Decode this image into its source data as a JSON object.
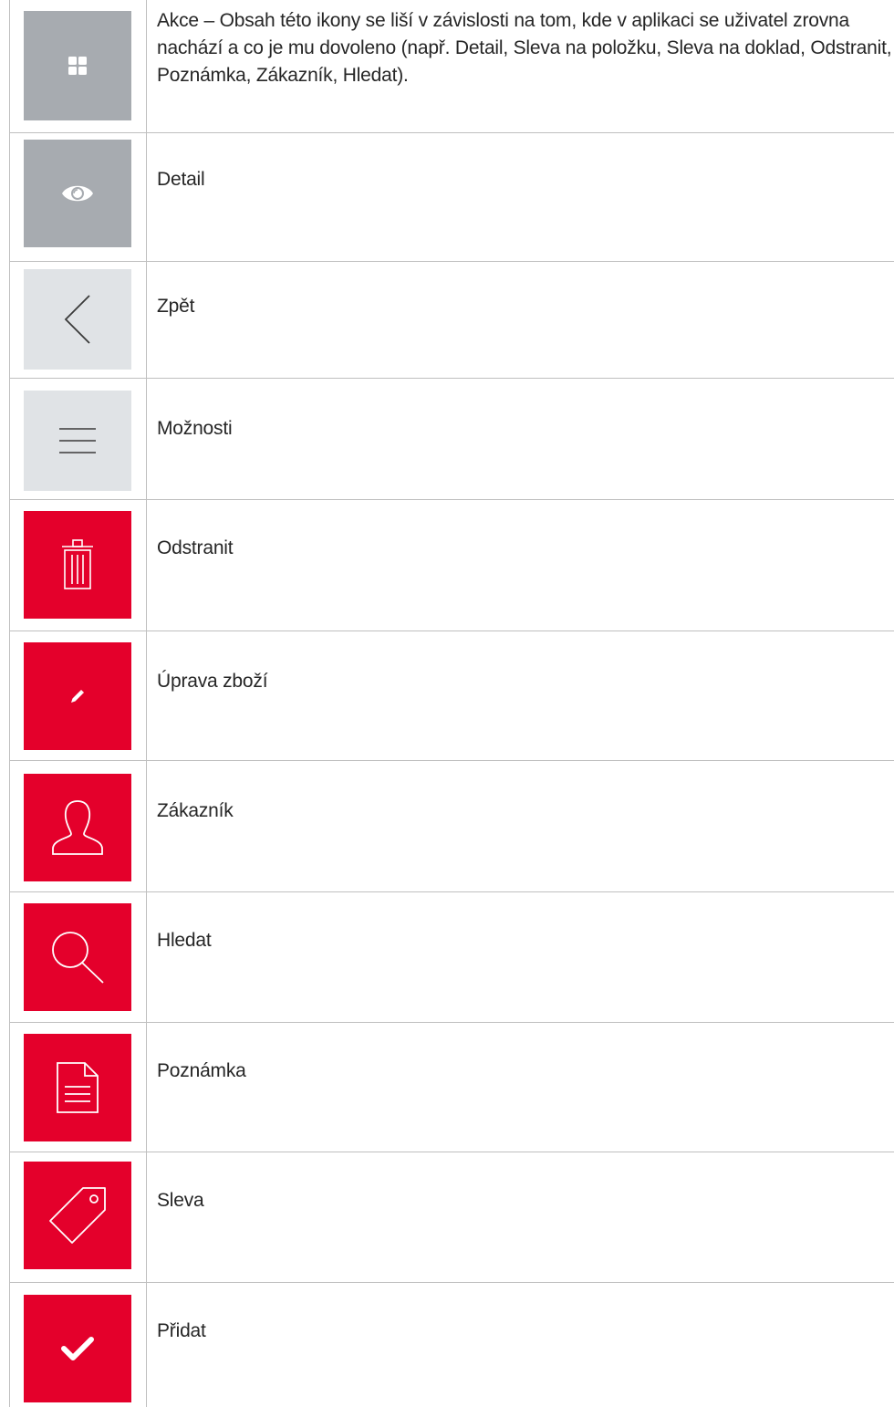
{
  "rows": [
    {
      "label": "Akce – Obsah této ikony se liší v závislosti na tom, kde v aplikaci se uživatel zrovna nachází a co je mu dovoleno (např. Detail, Sleva na položku, Sleva na doklad, Odstranit, Poznámka, Zákazník, Hledat).",
      "icon": "grid-icon",
      "tile_color": "#a7abb0"
    },
    {
      "label": "Detail",
      "icon": "eye-icon",
      "tile_color": "#a7abb0"
    },
    {
      "label": "Zpět",
      "icon": "chevron-left-icon",
      "tile_color": "#e0e3e6"
    },
    {
      "label": "Možnosti",
      "icon": "menu-icon",
      "tile_color": "#e0e3e6"
    },
    {
      "label": "Odstranit",
      "icon": "trash-icon",
      "tile_color": "#e4002b"
    },
    {
      "label": "Úprava zboží",
      "icon": "pencil-icon",
      "tile_color": "#e4002b"
    },
    {
      "label": "Zákazník",
      "icon": "user-icon",
      "tile_color": "#e4002b"
    },
    {
      "label": "Hledat",
      "icon": "search-icon",
      "tile_color": "#e4002b"
    },
    {
      "label": "Poznámka",
      "icon": "note-icon",
      "tile_color": "#e4002b"
    },
    {
      "label": "Sleva",
      "icon": "tag-icon",
      "tile_color": "#e4002b"
    },
    {
      "label": "Přidat",
      "icon": "check-icon",
      "tile_color": "#e4002b"
    }
  ]
}
